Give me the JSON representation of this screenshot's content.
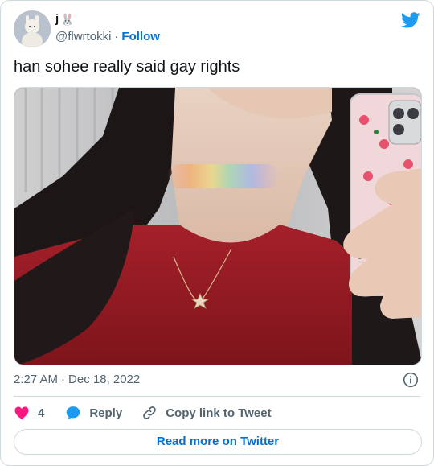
{
  "author": {
    "display_name": "j",
    "badge_emoji": "🐰",
    "handle": "@flwrtokki",
    "separator": "·",
    "follow_label": "Follow"
  },
  "tweet": {
    "text": "han sohee really said gay rights",
    "time": "2:27 AM",
    "separator": "·",
    "date": "Dec 18, 2022"
  },
  "actions": {
    "like_count": "4",
    "reply_label": "Reply",
    "copy_label": "Copy link to Tweet"
  },
  "footer": {
    "read_more_label": "Read more on Twitter"
  },
  "colors": {
    "link": "#006fd6",
    "like": "#f91880",
    "reply": "#1d9bf0",
    "twitter_brand": "#1d9bf0"
  },
  "icons": {
    "brand": "twitter-bird-icon",
    "info": "info-icon",
    "like": "heart-icon",
    "reply": "speech-bubble-icon",
    "copy": "link-icon"
  }
}
